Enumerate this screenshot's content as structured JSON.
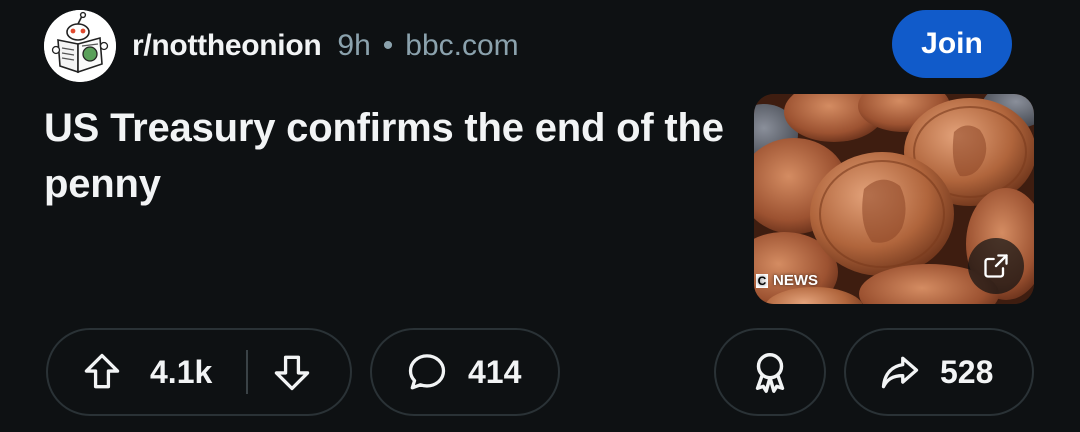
{
  "post": {
    "subreddit": "r/nottheonion",
    "age": "9h",
    "separator": "•",
    "domain": "bbc.com",
    "join_label": "Join",
    "title": "US Treasury confirms the end of the penny",
    "thumbnail": {
      "badge_mark": "C",
      "badge_text": "NEWS",
      "external_icon": "external-link-icon"
    }
  },
  "actions": {
    "upvote_icon": "arrow-up-icon",
    "score": "4.1k",
    "downvote_icon": "arrow-down-icon",
    "comment_icon": "speech-bubble-icon",
    "comments": "414",
    "award_icon": "award-ribbon-icon",
    "share_icon": "share-arrow-icon",
    "shares": "528"
  },
  "colors": {
    "background": "#0e1113",
    "join_button": "#115bca",
    "muted_text": "#8ba2ad",
    "pill_border": "#2a3236"
  }
}
